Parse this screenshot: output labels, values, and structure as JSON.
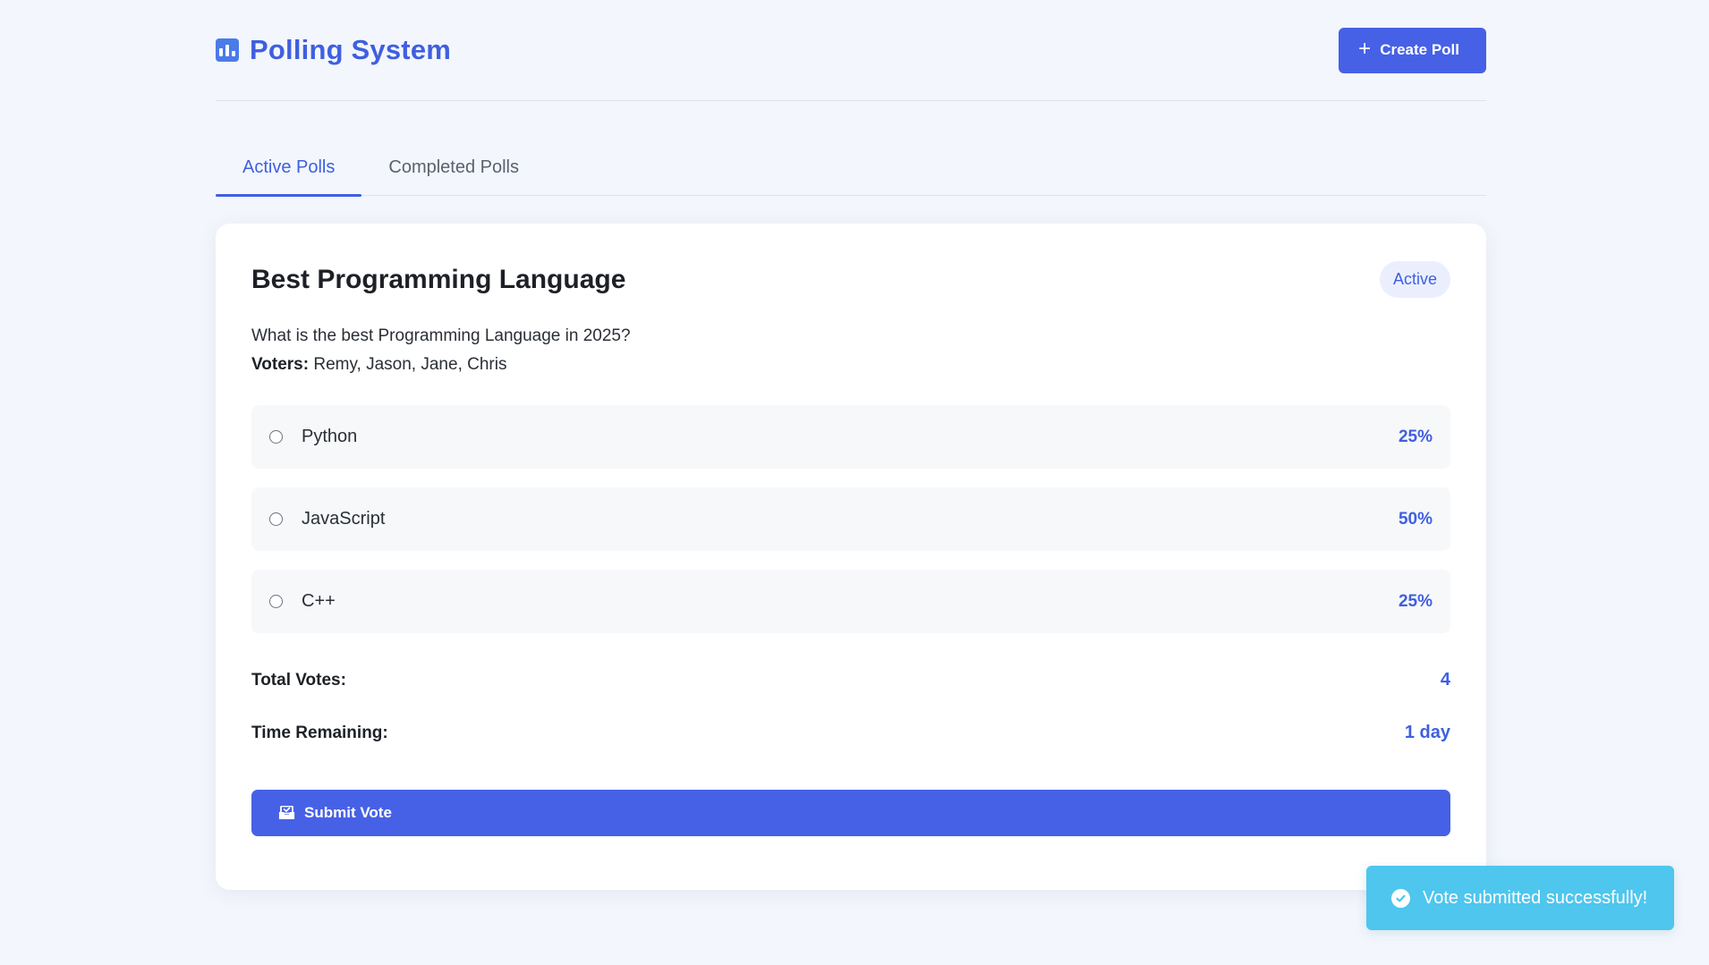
{
  "app": {
    "title": "Polling System",
    "icon": "bar-chart-icon",
    "accent_color": "#4661e6"
  },
  "header": {
    "create_button_label": "Create Poll",
    "create_button_icon": "plus-icon"
  },
  "tabs": [
    {
      "label": "Active Polls",
      "active": true
    },
    {
      "label": "Completed Polls",
      "active": false
    }
  ],
  "poll": {
    "title": "Best Programming Language",
    "status": "Active",
    "question": "What is the best Programming Language in 2025?",
    "voters_label": "Voters:",
    "voters": "Remy, Jason, Jane, Chris",
    "options": [
      {
        "label": "Python",
        "percent": "25%"
      },
      {
        "label": "JavaScript",
        "percent": "50%"
      },
      {
        "label": "C++",
        "percent": "25%"
      }
    ],
    "total_votes_label": "Total Votes:",
    "total_votes": "4",
    "time_remaining_label": "Time Remaining:",
    "time_remaining": "1 day",
    "submit_label": "Submit Vote",
    "submit_icon": "inbox-icon"
  },
  "toast": {
    "message": "Vote submitted successfully!",
    "icon": "check-circle-icon",
    "color": "#4ec6ee"
  }
}
